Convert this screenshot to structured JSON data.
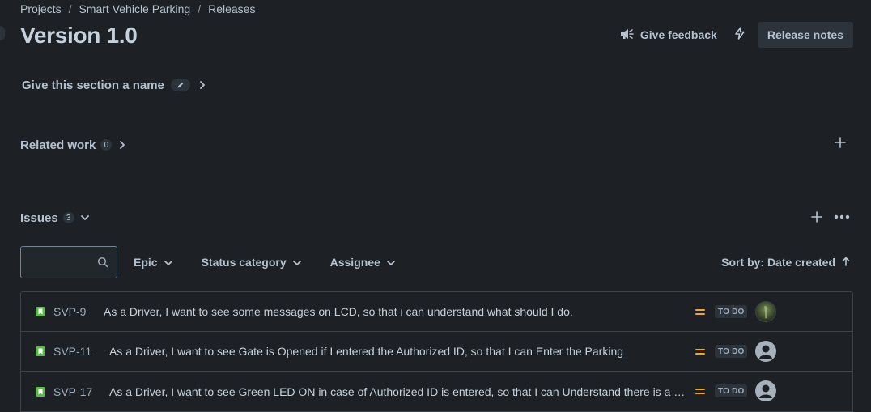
{
  "breadcrumb": [
    "Projects",
    "Smart Vehicle Parking",
    "Releases"
  ],
  "breadcrumb_separator": "/",
  "title": "Version 1.0",
  "header": {
    "feedback_label": "Give feedback",
    "bolt_icon": "lightning-bolt-icon",
    "release_notes_label": "Release notes"
  },
  "section_name": {
    "label": "Give this section a name",
    "edit_icon": "pencil-icon"
  },
  "related_work": {
    "label": "Related work",
    "count": "0"
  },
  "issues": {
    "label": "Issues",
    "count": "3"
  },
  "filters": {
    "search_value": "",
    "search_placeholder": "",
    "epic_label": "Epic",
    "status_category_label": "Status category",
    "assignee_label": "Assignee",
    "sort_label": "Sort by: Date created"
  },
  "issue_rows": [
    {
      "key": "SVP-9",
      "summary": "As a Driver, I want to see some messages on LCD, so that i can understand what should I do.",
      "status": "TO DO",
      "priority": "medium",
      "avatar": "photo-avatar"
    },
    {
      "key": "SVP-11",
      "summary": "As a Driver, I want to see Gate is Opened if I entered the Authorized ID, so that I can Enter the Parking",
      "status": "TO DO",
      "priority": "medium",
      "avatar": "default-avatar"
    },
    {
      "key": "SVP-17",
      "summary": "As a Driver, I want to see Green LED ON in case of Authorized ID is entered, so that I can Understand there is a Per...",
      "status": "TO DO",
      "priority": "medium",
      "avatar": "default-avatar"
    }
  ],
  "colors": {
    "background": "#1d2125",
    "text": "#c7d1db",
    "story": "#5fb84e",
    "priority_medium": "#f5a623",
    "button_bg": "#2c333a"
  }
}
